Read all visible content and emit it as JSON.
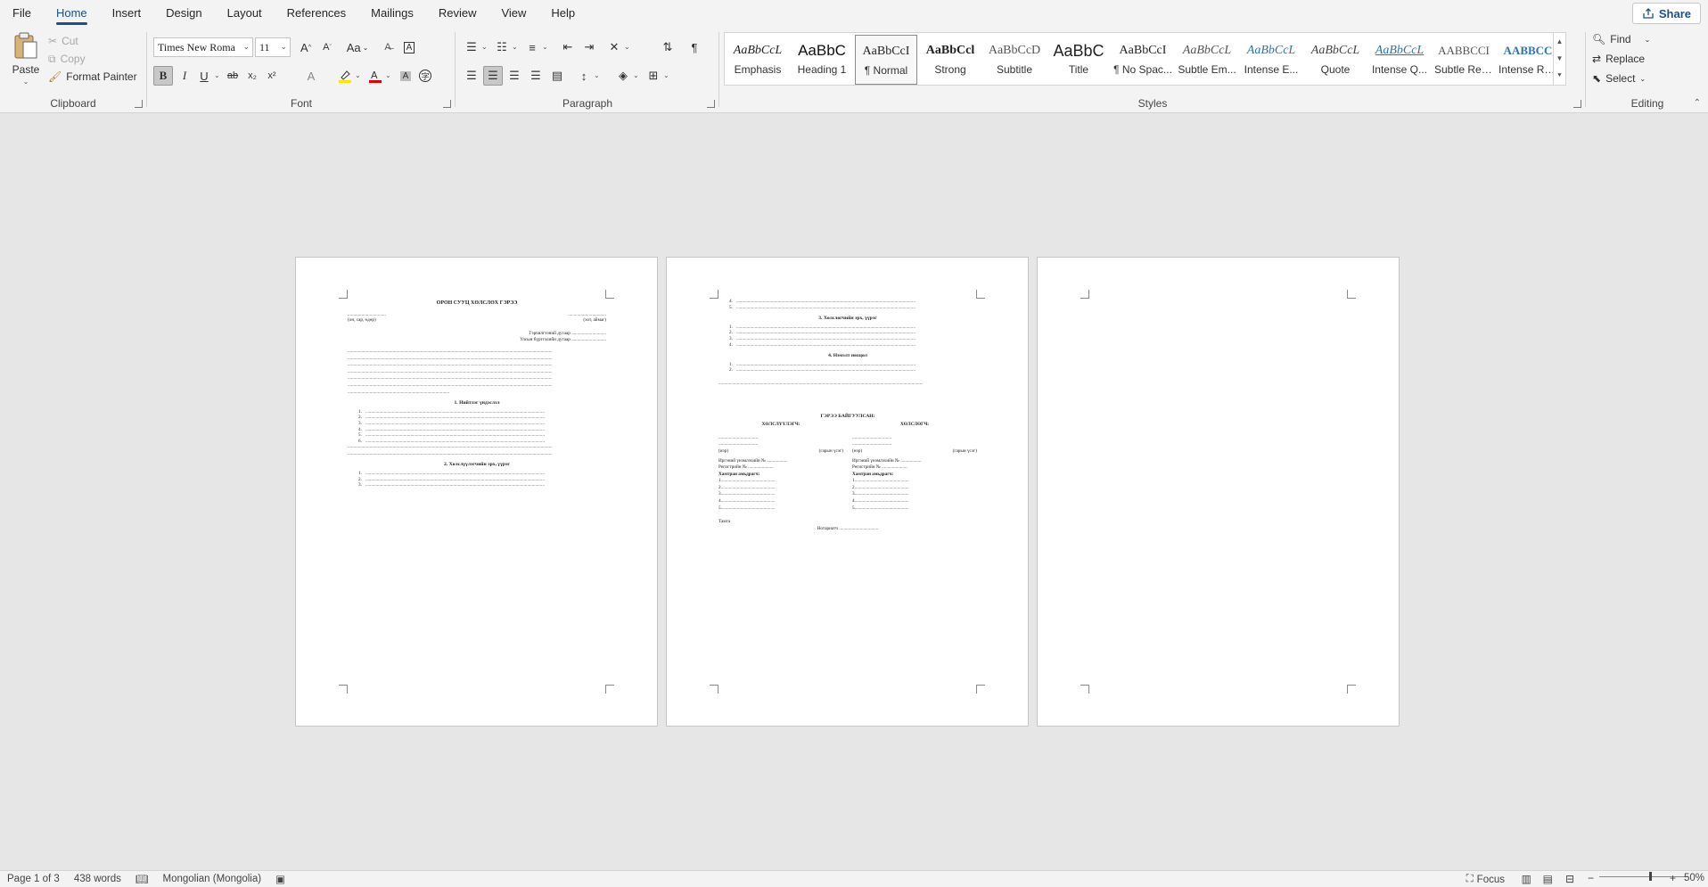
{
  "menu": {
    "items": [
      "File",
      "Home",
      "Insert",
      "Design",
      "Layout",
      "References",
      "Mailings",
      "Review",
      "View",
      "Help"
    ],
    "active": "Home",
    "share_label": "Share"
  },
  "clipboard": {
    "paste": "Paste",
    "cut": "Cut",
    "copy": "Copy",
    "format_painter": "Format Painter",
    "label": "Clipboard"
  },
  "font": {
    "family": "Times New Roma",
    "size": "11",
    "grow": "A",
    "shrink": "A",
    "case": "Aa",
    "bold": "B",
    "italic": "I",
    "underline": "U",
    "strike": "ab",
    "subscript": "x₂",
    "superscript": "x²",
    "label": "Font"
  },
  "paragraph": {
    "label": "Paragraph"
  },
  "styles": {
    "label": "Styles",
    "items": [
      {
        "preview": "AaBbCcL",
        "name": "Emphasis"
      },
      {
        "preview": "AaBbC",
        "name": "Heading 1"
      },
      {
        "preview": "AaBbCcI",
        "name": "¶ Normal"
      },
      {
        "preview": "AaBbCcl",
        "name": "Strong"
      },
      {
        "preview": "AaBbCcD",
        "name": "Subtitle"
      },
      {
        "preview": "AaBbC",
        "name": "Title"
      },
      {
        "preview": "AaBbCcI",
        "name": "¶ No Spac..."
      },
      {
        "preview": "AaBbCcL",
        "name": "Subtle Em..."
      },
      {
        "preview": "AaBbCcL",
        "name": "Intense E..."
      },
      {
        "preview": "AaBbCcL",
        "name": "Quote"
      },
      {
        "preview": "AaBbCcL",
        "name": "Intense Q..."
      },
      {
        "preview": "AABBCCI",
        "name": "Subtle Ref..."
      },
      {
        "preview": "AABBCC",
        "name": "Intense Re..."
      }
    ],
    "selected_index": 2,
    "accent": "#2e74b5"
  },
  "editing": {
    "find": "Find",
    "replace": "Replace",
    "select": "Select",
    "label": "Editing"
  },
  "status": {
    "page": "Page 1 of 3",
    "words": "438 words",
    "language": "Mongolian (Mongolia)",
    "focus": "Focus",
    "zoom": "50%"
  },
  "doc": {
    "title": "ОРОН СУУЦ ХӨЛСЛӨХ ГЭРЭЭ",
    "place": "(он, сар, өдөр)",
    "city": "(хот, аймаг)",
    "registry": "Гэрчилгээний дугаар",
    "land": "Улсын бүртгэлийн дугаар",
    "s1": "1.   Нийтлэг үндэслэл",
    "s2": "2.   Хөлслүүлэгчийн эрх, үүрэг",
    "s3": "3.   Хөлслөгчийн эрх, үүрэг",
    "s4": "4.   Нэмэлт нөхцөл",
    "sign_title": "ГЭРЭЭ БАЙГУУЛСАН:",
    "lessor": "ХӨЛСЛҮҮЛЭГЧ:",
    "lessee": "ХӨЛСЛӨГЧ:",
    "name_label": "(нэр)",
    "sign_label": "(гарын үсэг)",
    "citizen": "Иргэний үнэмлэхийн №",
    "register": "Регистрийн №",
    "cohabitants": "Хамтран амьдрагч:",
    "tamga": "Тамга",
    "notary": "Нотариатч"
  }
}
